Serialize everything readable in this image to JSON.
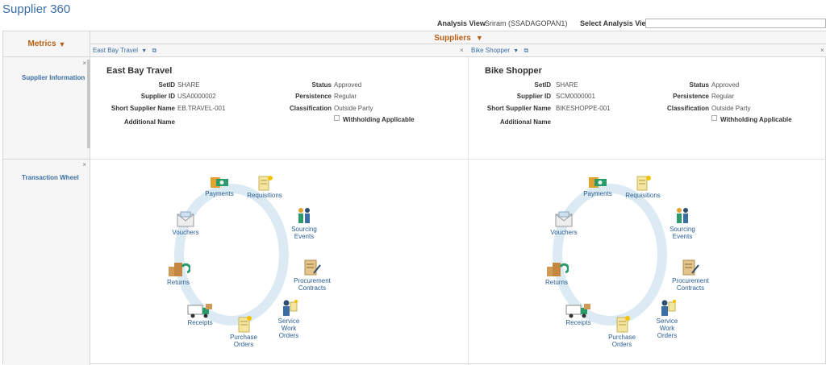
{
  "page": {
    "title": "Supplier 360"
  },
  "analysis": {
    "view_label": "Analysis View",
    "view_value": "Sriram (SSADAGOPAN1)",
    "select_label": "Select Analysis View",
    "select_value": ""
  },
  "grid": {
    "metrics_label": "Metrics",
    "suppliers_label": "Suppliers",
    "rows": [
      {
        "label": "Supplier Information",
        "close": "×"
      },
      {
        "label": "Transaction Wheel",
        "close": "×"
      }
    ],
    "close_glyph": "×",
    "popup_glyph": "⧉"
  },
  "suppliers": [
    {
      "header": "East Bay Travel",
      "name": "East Bay Travel",
      "fields": {
        "setid_label": "SetID",
        "setid": "SHARE",
        "supplier_id_label": "Supplier ID",
        "supplier_id": "USA0000002",
        "short_name_label": "Short Supplier Name",
        "short_name": "EB.TRAVEL-001",
        "additional_name_label": "Additional Name",
        "additional_name": "",
        "status_label": "Status",
        "status": "Approved",
        "persistence_label": "Persistence",
        "persistence": "Regular",
        "classification_label": "Classification",
        "classification": "Outside Party",
        "withholding_label": "Withholding Applicable"
      }
    },
    {
      "header": "Bike Shopper",
      "name": "Bike Shopper",
      "fields": {
        "setid_label": "SetID",
        "setid": "SHARE",
        "supplier_id_label": "Supplier ID",
        "supplier_id": "SCM0000001",
        "short_name_label": "Short Supplier Name",
        "short_name": "BIKESHOPPE-001",
        "additional_name_label": "Additional Name",
        "additional_name": "",
        "status_label": "Status",
        "status": "Approved",
        "persistence_label": "Persistence",
        "persistence": "Regular",
        "classification_label": "Classification",
        "classification": "Outside Party",
        "withholding_label": "Withholding Applicable"
      }
    }
  ],
  "wheel": {
    "payments": "Payments",
    "requisitions": "Requisitions",
    "sourcing_1": "Sourcing",
    "sourcing_2": "Events",
    "procurement_1": "Procurement",
    "procurement_2": "Contracts",
    "service_1": "Service",
    "service_2": "Work",
    "service_3": "Orders",
    "purchase_1": "Purchase",
    "purchase_2": "Orders",
    "receipts": "Receipts",
    "returns": "Returns",
    "vouchers": "Vouchers"
  },
  "colors": {
    "accent": "#b85e13",
    "link": "#3b6ea5",
    "ring": "#dcebf3"
  }
}
